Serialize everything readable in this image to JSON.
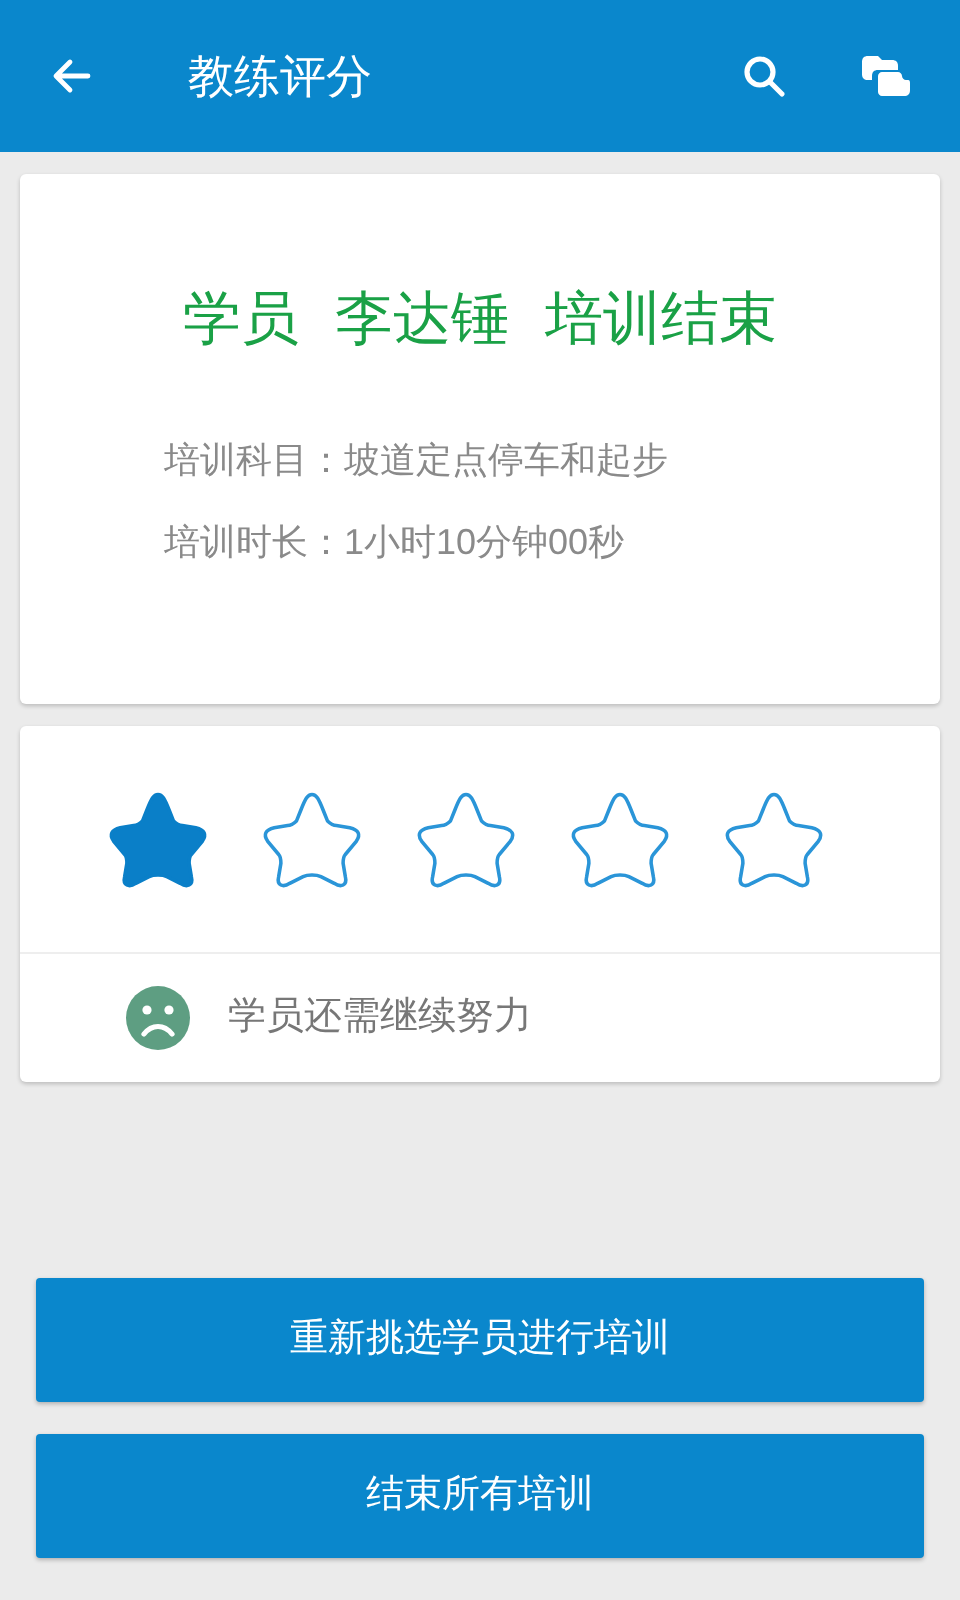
{
  "app_bar": {
    "title": "教练评分"
  },
  "summary": {
    "headline": [
      "学员",
      "李达锤",
      "培训结束"
    ],
    "details": [
      "培训科目：坡道定点停车和起步",
      "培训时长：1小时10分钟00秒"
    ]
  },
  "rating": {
    "stars": 1,
    "feedback": "学员还需继续努力"
  },
  "buttons": [
    "重新挑选学员进行培训",
    "结束所有培训"
  ]
}
